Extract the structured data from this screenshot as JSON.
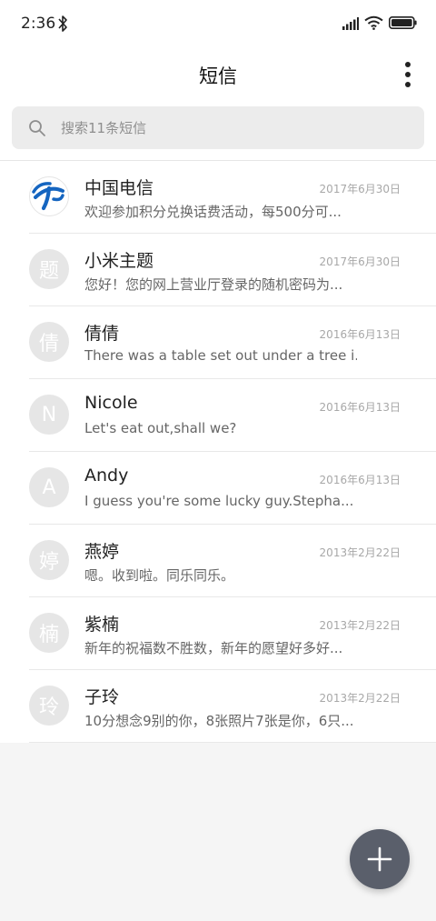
{
  "status_bar": {
    "time": "2:36",
    "icons": [
      "bluetooth-icon",
      "signal-icon",
      "wifi-icon",
      "battery-icon"
    ]
  },
  "header": {
    "title": "短信",
    "menu_icon": "more-vertical-icon"
  },
  "search": {
    "placeholder": "搜索11条短信",
    "icon": "search-icon"
  },
  "conversations": [
    {
      "name": "中国电信",
      "date": "2017年6月30日",
      "snippet": "欢迎参加积分兑换话费活动，每500分可...",
      "avatar": "",
      "avatar_type": "china-telecom-logo"
    },
    {
      "name": "小米主题",
      "date": "2017年6月30日",
      "snippet": "您好！您的网上营业厅登录的随机密码为...",
      "avatar": "题"
    },
    {
      "name": "倩倩",
      "date": "2016年6月13日",
      "snippet": "There was a table set out under a tree i...",
      "avatar": "倩"
    },
    {
      "name": "Nicole",
      "date": "2016年6月13日",
      "snippet": "Let's eat out,shall we?",
      "avatar": "N"
    },
    {
      "name": "Andy",
      "date": "2016年6月13日",
      "snippet": "I guess you're some lucky guy.Stepha...",
      "avatar": "A"
    },
    {
      "name": "燕婷",
      "date": "2013年2月22日",
      "snippet": "嗯。收到啦。同乐同乐。",
      "avatar": "婷"
    },
    {
      "name": "紫楠",
      "date": "2013年2月22日",
      "snippet": "新年的祝福数不胜数，新年的愿望好多好...",
      "avatar": "楠"
    },
    {
      "name": "子玲",
      "date": "2013年2月22日",
      "snippet": "10分想念9别的你，8张照片7张是你，6只...",
      "avatar": "玲"
    }
  ],
  "fab": {
    "icon": "plus-icon"
  },
  "colors": {
    "avatar_bg": "#e6e6e6",
    "fab_bg": "#5a5f6b",
    "telecom_blue": "#1565c0"
  }
}
